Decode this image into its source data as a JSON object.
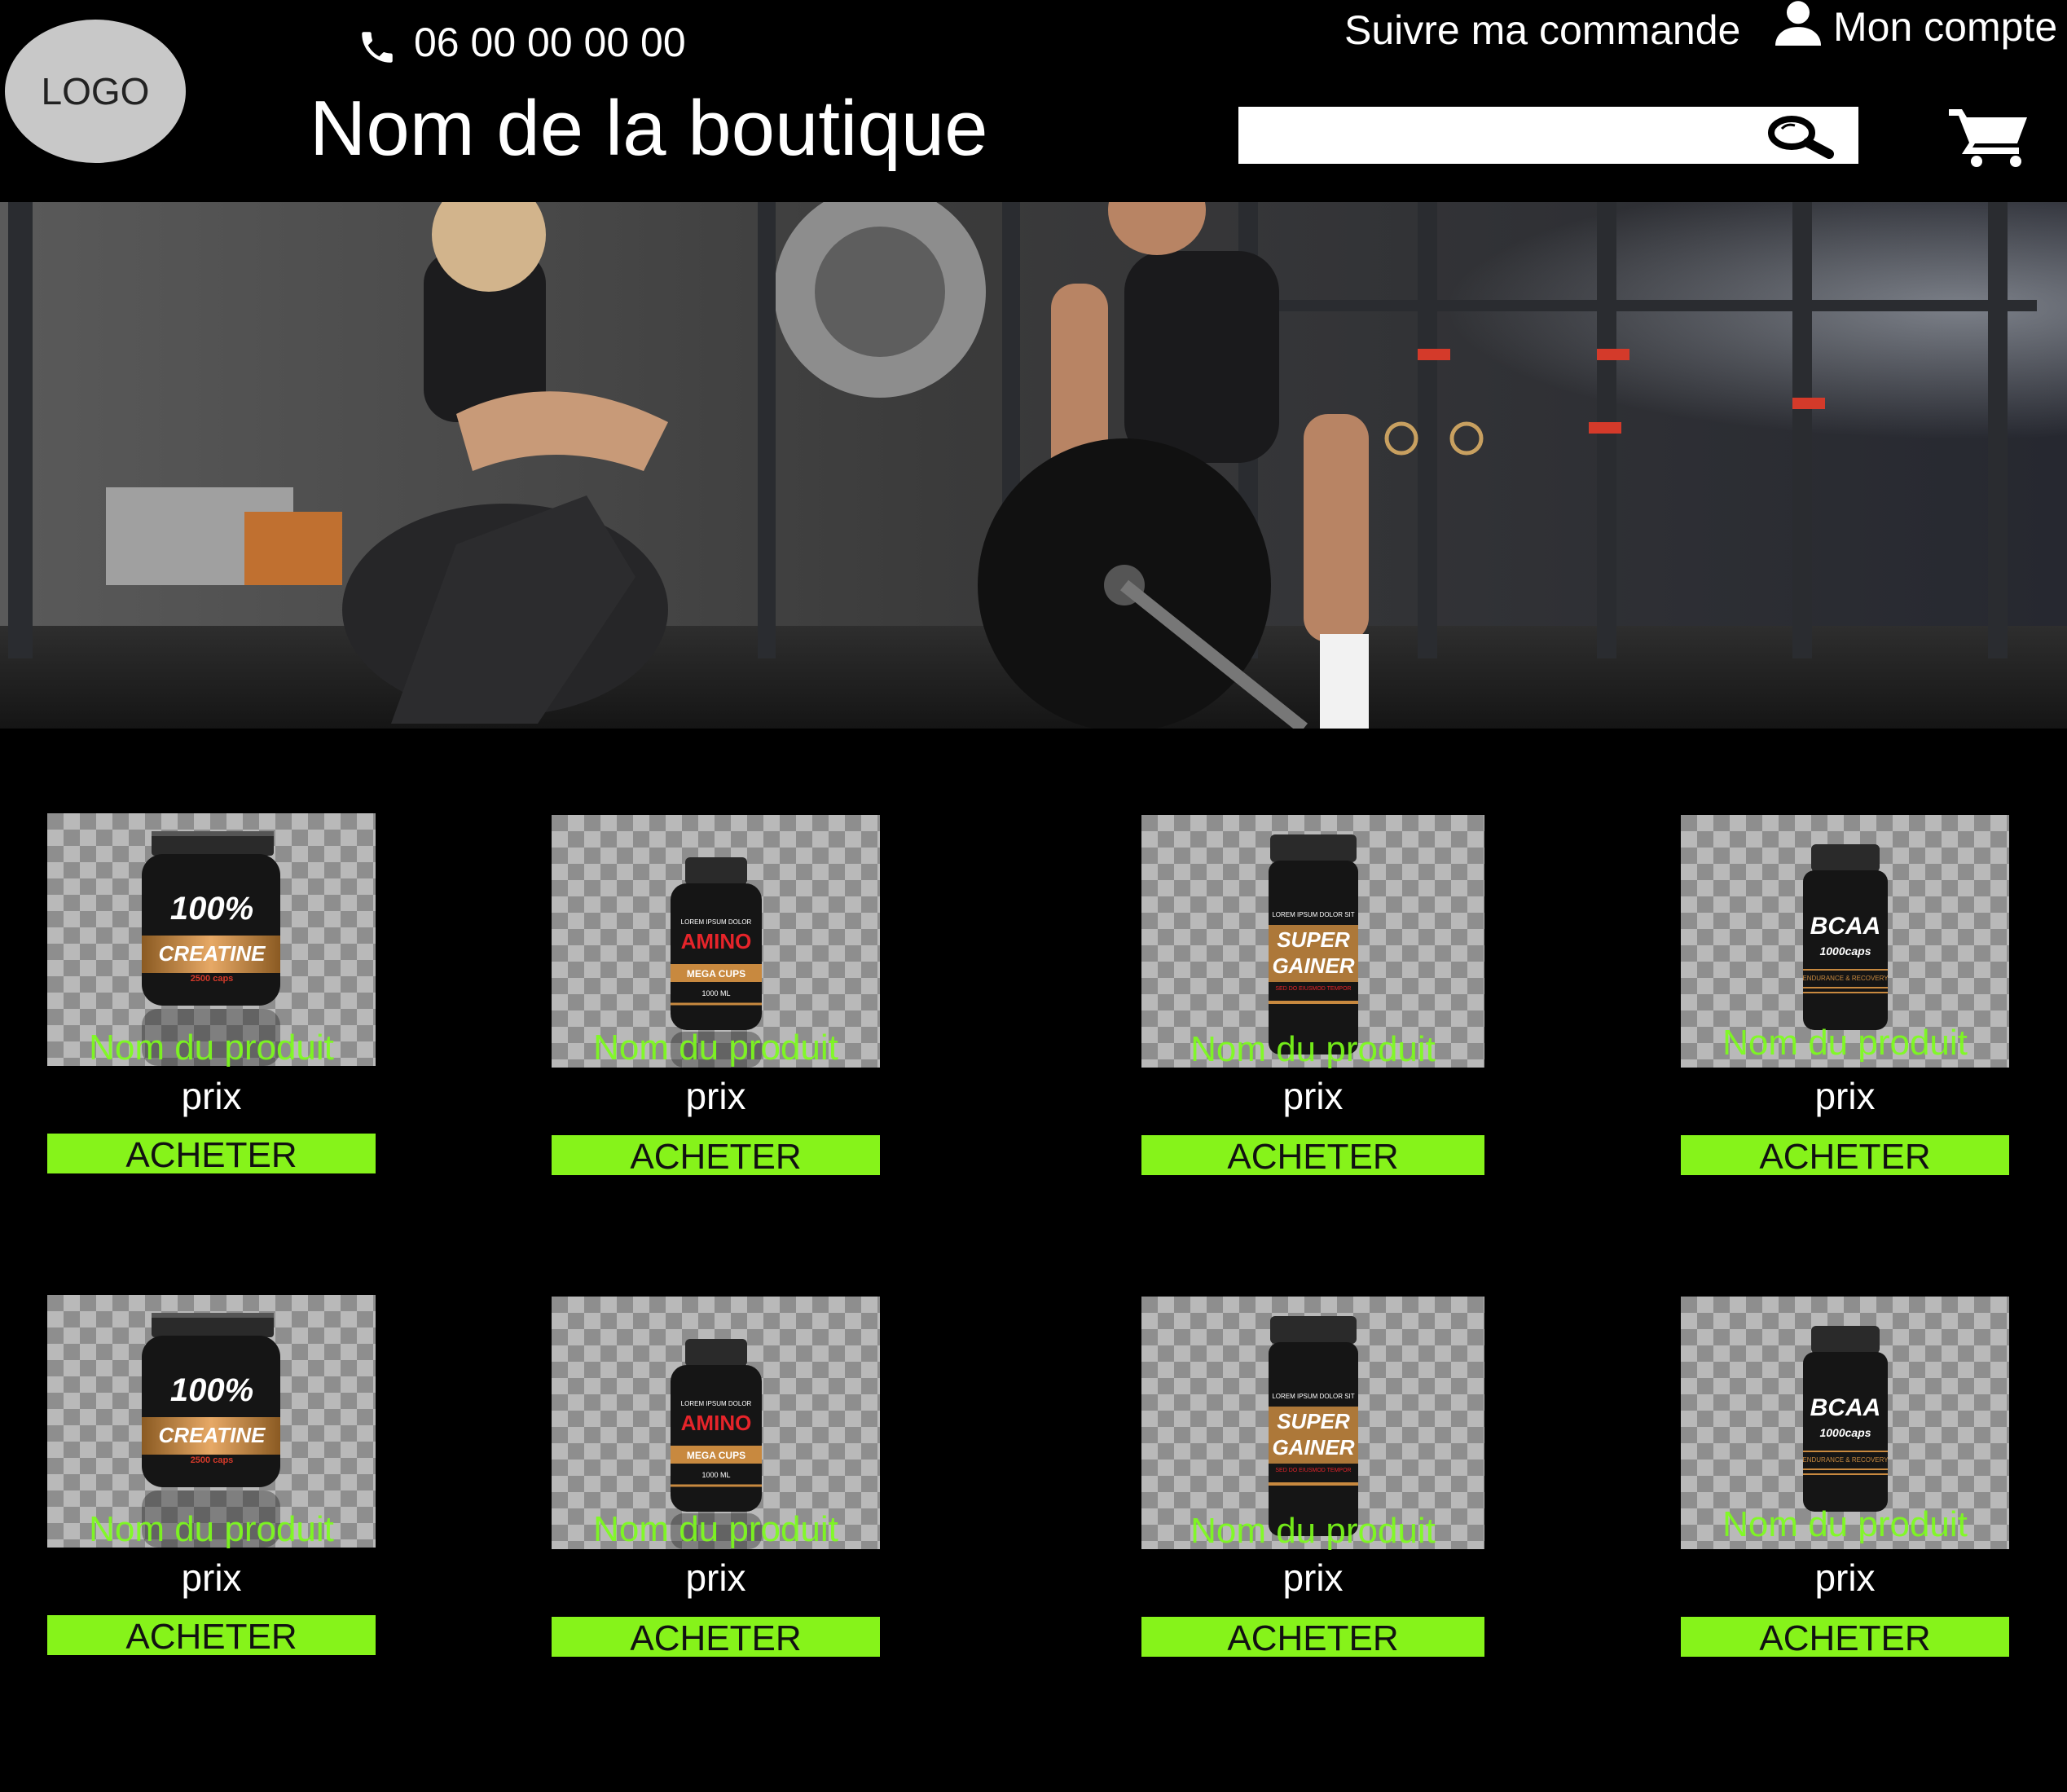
{
  "header": {
    "logo": "LOGO",
    "phone": "06 00 00 00 00",
    "shop_name": "Nom de la boutique",
    "track_order": "Suivre ma commande",
    "account": "Mon compte",
    "search_placeholder": "",
    "icons": [
      "phone-icon",
      "user-icon",
      "search-icon",
      "cart-icon"
    ]
  },
  "colors": {
    "background": "#000000",
    "accent_button": "#86f31a",
    "product_name": "#7dff1a",
    "logo_bg": "#c8c8c8"
  },
  "products": [
    {
      "name": "Nom du produit",
      "price": "prix",
      "button": "ACHETER",
      "jar": "creatine"
    },
    {
      "name": "Nom du produit",
      "price": "prix",
      "button": "ACHETER",
      "jar": "amino"
    },
    {
      "name": "Nom du produit",
      "price": "prix",
      "button": "ACHETER",
      "jar": "gainer"
    },
    {
      "name": "Nom du produit",
      "price": "prix",
      "button": "ACHETER",
      "jar": "bcaa"
    },
    {
      "name": "Nom du produit",
      "price": "prix",
      "button": "ACHETER",
      "jar": "creatine"
    },
    {
      "name": "Nom du produit",
      "price": "prix",
      "button": "ACHETER",
      "jar": "amino"
    },
    {
      "name": "Nom du produit",
      "price": "prix",
      "button": "ACHETER",
      "jar": "gainer"
    },
    {
      "name": "Nom du produit",
      "price": "prix",
      "button": "ACHETER",
      "jar": "bcaa"
    }
  ],
  "jars": {
    "creatine": {
      "line1": "100%",
      "line2": "CREATINE",
      "line3": "2500 caps"
    },
    "amino": {
      "line0": "LOREM IPSUM DOLOR",
      "line1": "AMINO",
      "line2": "MEGA CUPS",
      "line3": "1000 ML"
    },
    "gainer": {
      "line0": "LOREM IPSUM DOLOR SIT",
      "line1": "SUPER",
      "line2": "GAINER",
      "line3": "SED DO EIUSMOD TEMPOR"
    },
    "bcaa": {
      "line1": "BCAA",
      "line2": "1000caps",
      "line3": "ENDURANCE & RECOVERY"
    }
  }
}
